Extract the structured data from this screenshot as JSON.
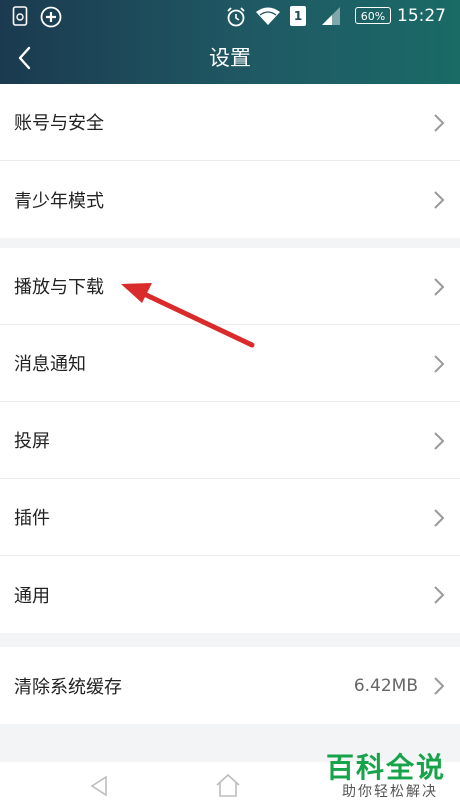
{
  "status_bar": {
    "time": "15:27",
    "battery": "60%",
    "sim": "1"
  },
  "header": {
    "title": "设置"
  },
  "groups": [
    [
      {
        "label": "账号与安全"
      },
      {
        "label": "青少年模式"
      }
    ],
    [
      {
        "label": "播放与下载"
      },
      {
        "label": "消息通知"
      },
      {
        "label": "投屏"
      },
      {
        "label": "插件"
      },
      {
        "label": "通用"
      }
    ],
    [
      {
        "label": "清除系统缓存",
        "value": "6.42MB"
      }
    ]
  ],
  "watermark": {
    "main": "百科全说",
    "sub": "助你轻松解决"
  },
  "colors": {
    "accent_annotation": "#d92b2b",
    "watermark_green": "#17a34a"
  }
}
